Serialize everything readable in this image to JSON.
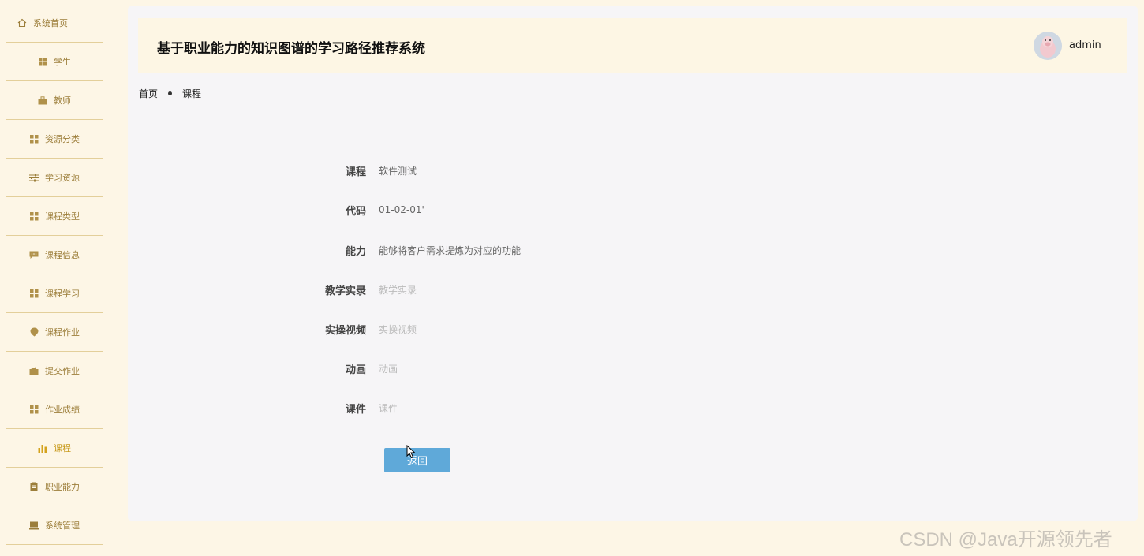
{
  "sidebar": {
    "home": {
      "label": "系统首页",
      "icon": "home-icon"
    },
    "items": [
      {
        "label": "学生",
        "icon": "grid-icon"
      },
      {
        "label": "教师",
        "icon": "briefcase-icon"
      },
      {
        "label": "资源分类",
        "icon": "grid-icon"
      },
      {
        "label": "学习资源",
        "icon": "sliders-icon"
      },
      {
        "label": "课程类型",
        "icon": "grid-icon"
      },
      {
        "label": "课程信息",
        "icon": "chat-icon"
      },
      {
        "label": "课程学习",
        "icon": "grid-icon"
      },
      {
        "label": "课程作业",
        "icon": "pin-icon"
      },
      {
        "label": "提交作业",
        "icon": "wallet-icon"
      },
      {
        "label": "作业成绩",
        "icon": "grid-icon"
      },
      {
        "label": "课程",
        "icon": "bar-chart-icon",
        "active": true
      },
      {
        "label": "职业能力",
        "icon": "clipboard-icon"
      },
      {
        "label": "系统管理",
        "icon": "monitor-icon"
      }
    ]
  },
  "header": {
    "title": "基于职业能力的知识图谱的学习路径推荐系统",
    "username": "admin"
  },
  "breadcrumb": {
    "home": "首页",
    "current": "课程"
  },
  "form": [
    {
      "label": "课程",
      "value": "软件测试",
      "placeholder": false
    },
    {
      "label": "代码",
      "value": "01-02-01'",
      "placeholder": false
    },
    {
      "label": "能力",
      "value": "能够将客户需求提炼为对应的功能",
      "placeholder": false
    },
    {
      "label": "教学实录",
      "value": "教学实录",
      "placeholder": true
    },
    {
      "label": "实操视频",
      "value": "实操视频",
      "placeholder": true
    },
    {
      "label": "动画",
      "value": "动画",
      "placeholder": true
    },
    {
      "label": "课件",
      "value": "课件",
      "placeholder": true
    }
  ],
  "buttons": {
    "back": "返回"
  },
  "watermark": "CSDN @Java开源领先者",
  "colors": {
    "accent": "#c89a1c",
    "button": "#5fa9d9",
    "sidebar_bg": "#fdf6e6"
  }
}
